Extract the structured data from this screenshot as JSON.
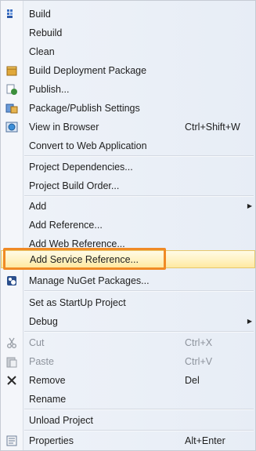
{
  "menu": {
    "items": [
      {
        "label": "Build",
        "icon": "build-icon"
      },
      {
        "label": "Rebuild"
      },
      {
        "label": "Clean"
      },
      {
        "label": "Build Deployment Package",
        "icon": "package-icon"
      },
      {
        "label": "Publish...",
        "icon": "publish-icon"
      },
      {
        "label": "Package/Publish Settings",
        "icon": "settings-icon"
      },
      {
        "label": "View in Browser",
        "icon": "browser-icon",
        "shortcut": "Ctrl+Shift+W"
      },
      {
        "label": "Convert to Web Application"
      },
      {
        "label": "Project Dependencies..."
      },
      {
        "label": "Project Build Order..."
      },
      {
        "label": "Add",
        "submenu": true
      },
      {
        "label": "Add Reference..."
      },
      {
        "label": "Add Web Reference..."
      },
      {
        "label": "Add Service Reference...",
        "selected": true
      },
      {
        "label": "Manage NuGet Packages...",
        "icon": "nuget-icon"
      },
      {
        "label": "Set as StartUp Project"
      },
      {
        "label": "Debug",
        "submenu": true
      },
      {
        "label": "Cut",
        "icon": "cut-icon",
        "shortcut": "Ctrl+X",
        "disabled": true
      },
      {
        "label": "Paste",
        "icon": "paste-icon",
        "shortcut": "Ctrl+V",
        "disabled": true
      },
      {
        "label": "Remove",
        "icon": "remove-icon",
        "shortcut": "Del"
      },
      {
        "label": "Rename"
      },
      {
        "label": "Unload Project"
      },
      {
        "label": "Properties",
        "icon": "properties-icon",
        "shortcut": "Alt+Enter"
      }
    ]
  },
  "colors": {
    "highlight_border": "#f08a25",
    "selected_fill": "#fff3c6"
  }
}
